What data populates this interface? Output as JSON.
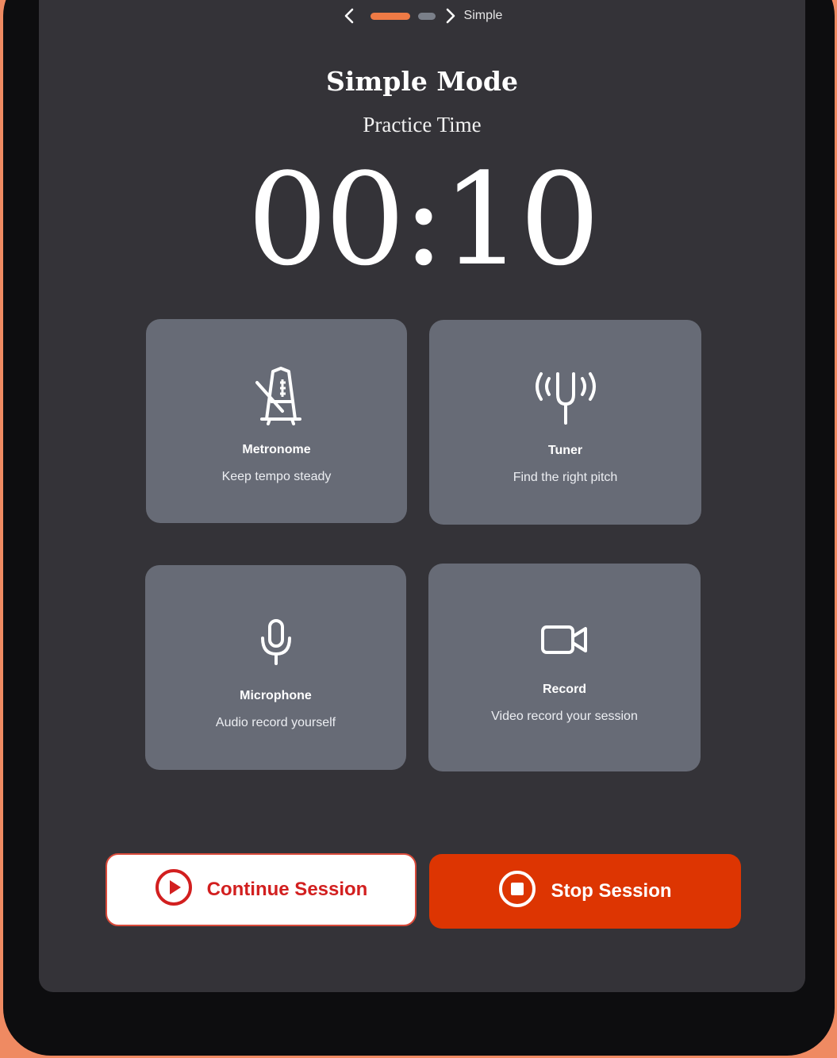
{
  "nav": {
    "back_icon": "chevron-left-icon",
    "forward_icon": "chevron-right-icon",
    "mode_label": "Simple",
    "accent": "#ee7a45"
  },
  "header": {
    "title": "Simple Mode",
    "subtitle": "Practice Time",
    "timer": "00:10"
  },
  "tools": [
    {
      "icon": "metronome-icon",
      "name": "Metronome",
      "description": "Keep tempo steady"
    },
    {
      "icon": "tuning-fork-icon",
      "name": "Tuner",
      "description": "Find the right pitch"
    },
    {
      "icon": "microphone-icon",
      "name": "Microphone",
      "description": "Audio record yourself"
    },
    {
      "icon": "video-camera-icon",
      "name": "Record",
      "description": "Video record your session"
    }
  ],
  "actions": {
    "continue_label": "Continue Session",
    "continue_icon": "play-circle-icon",
    "stop_label": "Stop Session",
    "stop_icon": "stop-circle-icon",
    "continue_color": "#d21f1f",
    "stop_color": "#dd3502"
  }
}
